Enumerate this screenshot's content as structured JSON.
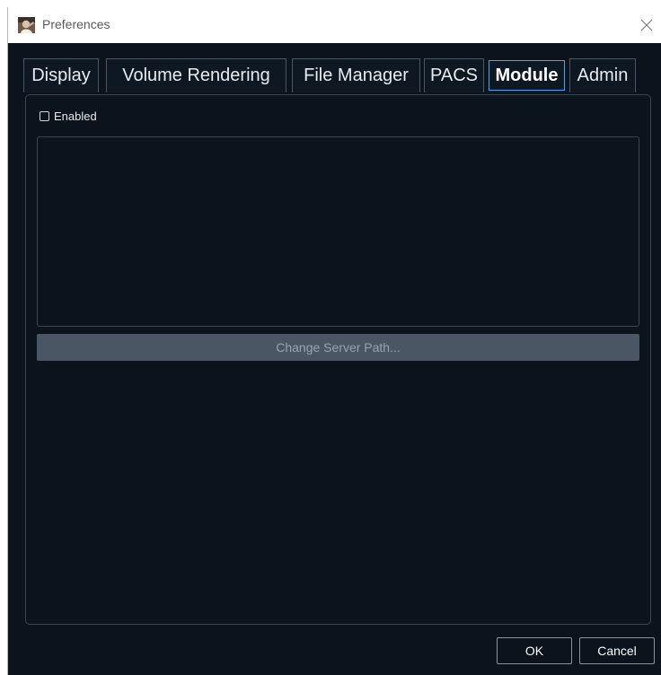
{
  "window": {
    "title": "Preferences",
    "app_icon": "app-portrait-icon",
    "close_icon": "close-icon"
  },
  "tabs": [
    {
      "label": "Display",
      "active": false
    },
    {
      "label": "Volume Rendering",
      "active": false
    },
    {
      "label": "File Manager",
      "active": false
    },
    {
      "label": "PACS",
      "active": false
    },
    {
      "label": "Module",
      "active": true
    },
    {
      "label": "Admin",
      "active": false
    }
  ],
  "module_panel": {
    "enabled_label": "Enabled",
    "enabled_checked": false,
    "change_server_path_label": "Change Server Path...",
    "change_server_path_disabled": true
  },
  "footer": {
    "ok_label": "OK",
    "cancel_label": "Cancel"
  },
  "colors": {
    "background": "#0b141d",
    "active_tab_border": "#4aa3ee",
    "tab_border": "#4b5561",
    "disabled_button": "#4a5663"
  }
}
